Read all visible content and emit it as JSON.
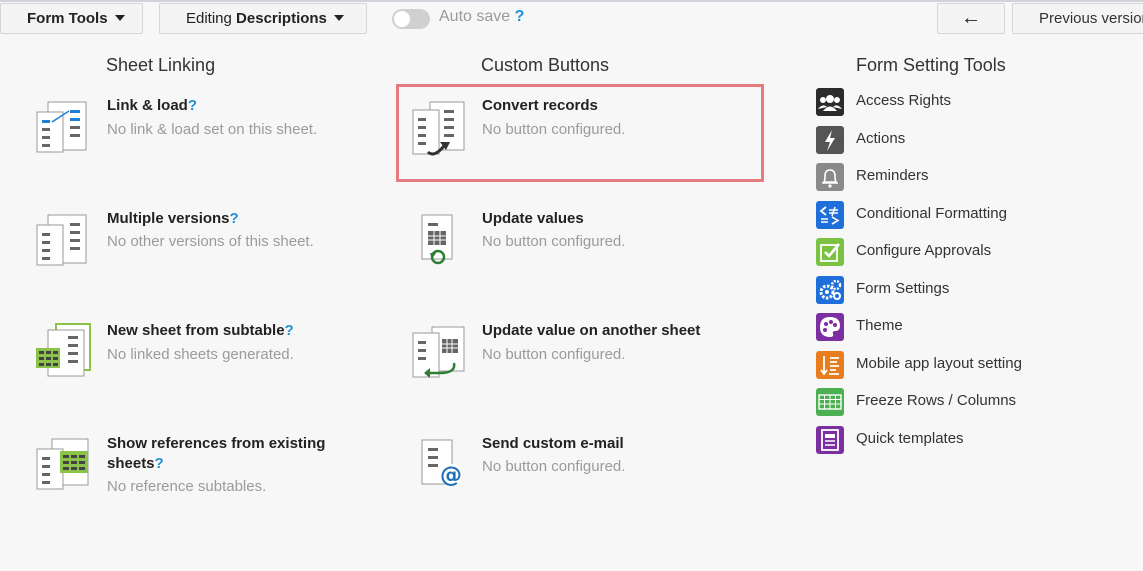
{
  "toolbar": {
    "form_tools_label": "Form Tools",
    "editing_prefix": "Editing",
    "editing_value": "Descriptions",
    "autosave_label": "Auto save",
    "autosave_help": "?",
    "back_arrow": "←",
    "previous_version_label": "Previous version"
  },
  "sheet_linking": {
    "title": "Sheet Linking",
    "items": [
      {
        "title": "Link & load",
        "help": "?",
        "sub": "No link & load set on this sheet."
      },
      {
        "title": "Multiple versions",
        "help": "?",
        "sub": "No other versions of this sheet."
      },
      {
        "title": "New sheet from subtable",
        "help": "?",
        "sub": "No linked sheets generated."
      },
      {
        "title_line1": "Show references from existing",
        "title_line2": "sheets",
        "help": "?",
        "sub": "No reference subtables."
      }
    ]
  },
  "custom_buttons": {
    "title": "Custom Buttons",
    "items": [
      {
        "title": "Convert records",
        "sub": "No button configured."
      },
      {
        "title": "Update values",
        "sub": "No button configured."
      },
      {
        "title": "Update value on another sheet",
        "sub": "No button configured."
      },
      {
        "title": "Send custom e-mail",
        "sub": "No button configured."
      }
    ]
  },
  "form_setting_tools": {
    "title": "Form Setting Tools",
    "items": [
      {
        "label": "Access Rights",
        "icon": "group-icon",
        "color": "#2b2b2b"
      },
      {
        "label": "Actions",
        "icon": "lightning-icon",
        "color": "#555555"
      },
      {
        "label": "Reminders",
        "icon": "bell-icon",
        "color": "#8a8a8a"
      },
      {
        "label": "Conditional Formatting",
        "icon": "conditional-icon",
        "color": "#1e6fd9"
      },
      {
        "label": "Configure Approvals",
        "icon": "check-icon",
        "color": "#7cc242"
      },
      {
        "label": "Form Settings",
        "icon": "gears-icon",
        "color": "#1e6fd9"
      },
      {
        "label": "Theme",
        "icon": "palette-icon",
        "color": "#7b2fa0"
      },
      {
        "label": "Mobile app layout setting",
        "icon": "mobile-layout-icon",
        "color": "#e87d1e"
      },
      {
        "label": "Freeze Rows / Columns",
        "icon": "freeze-icon",
        "color": "#4caf50"
      },
      {
        "label": "Quick templates",
        "icon": "template-icon",
        "color": "#7b2fa0"
      }
    ]
  }
}
